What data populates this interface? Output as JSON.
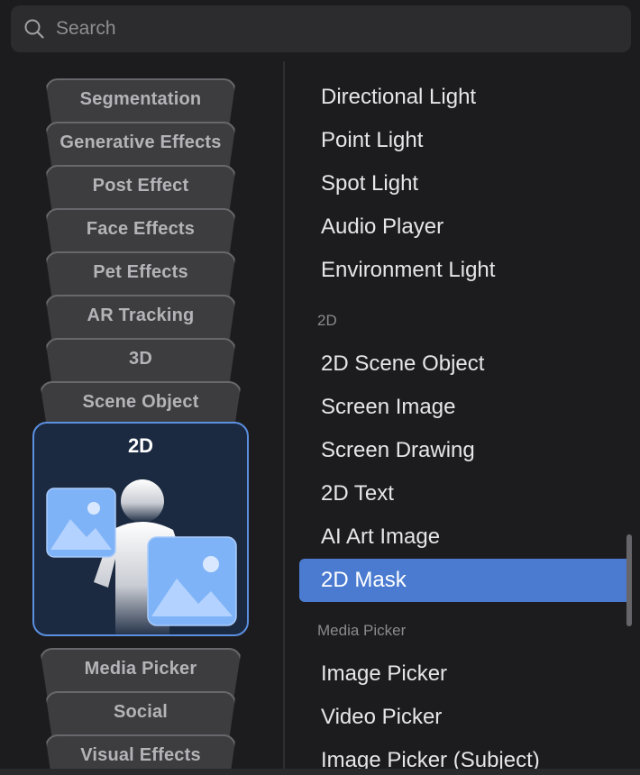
{
  "search": {
    "placeholder": "Search",
    "icon": "search-icon"
  },
  "categories": [
    "Segmentation",
    "Generative Effects",
    "Post Effect",
    "Face Effects",
    "Pet Effects",
    "AR Tracking",
    "3D",
    "Scene Object",
    "2D",
    "Media Picker",
    "Social",
    "Visual Effects"
  ],
  "active_category": {
    "title": "2D",
    "illustration": "person-with-image-icons"
  },
  "list": {
    "lights": [
      "Directional Light",
      "Point Light",
      "Spot Light",
      "Audio Player",
      "Environment Light"
    ],
    "section_2d": "2D",
    "items_2d": [
      "2D Scene Object",
      "Screen Image",
      "Screen Drawing",
      "2D Text",
      "AI Art Image",
      "2D Mask"
    ],
    "selected": "2D Mask",
    "section_media": "Media Picker",
    "items_media": [
      "Image Picker",
      "Video Picker",
      "Image Picker (Subject)"
    ]
  },
  "colors": {
    "background": "#1c1c1e",
    "accent": "#4a7bd1",
    "card_bg": "#1b2a41",
    "card_border": "#5b8fe0"
  }
}
